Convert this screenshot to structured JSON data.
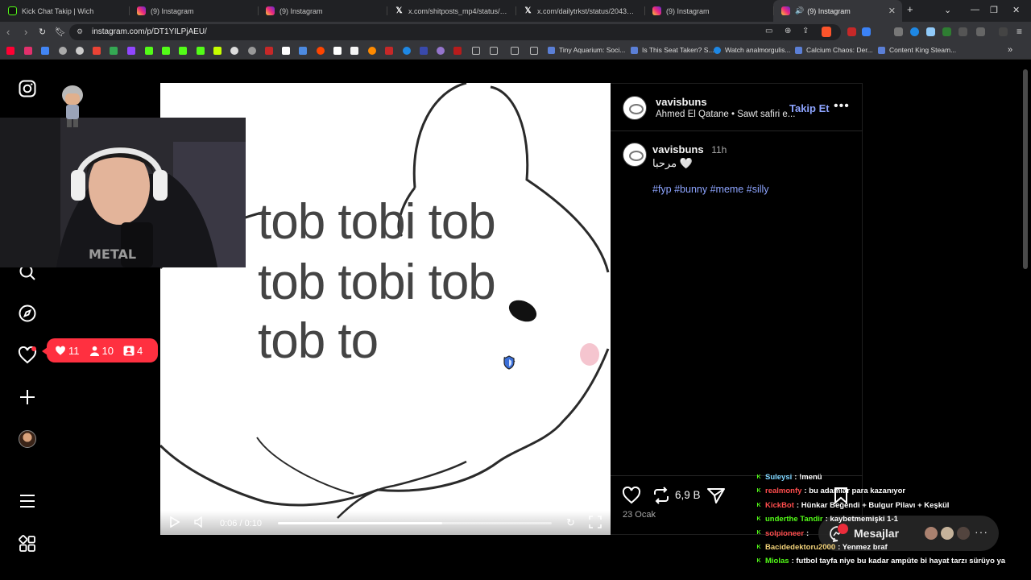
{
  "tabs": [
    {
      "title": "Kick Chat Takip | Wich",
      "icon": "kick-logo-icon"
    },
    {
      "title": "(9) Instagram",
      "icon": "instagram-icon"
    },
    {
      "title": "(9) Instagram",
      "icon": "instagram-icon"
    },
    {
      "title": "x.com/shitposts_mp4/status/20434",
      "icon": "x-icon"
    },
    {
      "title": "x.com/dailytrkst/status/204365050",
      "icon": "x-icon"
    },
    {
      "title": "(9) Instagram",
      "icon": "instagram-icon"
    },
    {
      "title": "(9) Instagram",
      "icon": "instagram-icon",
      "active": true
    }
  ],
  "address": {
    "url": "instagram.com/p/DT1YILPjAEU/"
  },
  "bookmarks": [
    {
      "label": "Tiny Aquarium: Soci..."
    },
    {
      "label": "Is This Seat Taken? S..."
    },
    {
      "label": "Watch analmorgulis..."
    },
    {
      "label": "Calcium Chaos: Der..."
    },
    {
      "label": "Content King Steam..."
    }
  ],
  "notifications": {
    "likes": "11",
    "follows": "10",
    "tags": "4"
  },
  "video": {
    "meme_lines": [
      "tob tobi tob",
      "tob tobi tob",
      "tob to"
    ],
    "time": "0:06 / 0:10",
    "progress": 0.6
  },
  "post": {
    "username": "vavisbuns",
    "audio": "Ahmed El Qatane • Sawt safiri e...",
    "follow_label": "Takip Et",
    "caption_user": "vavisbuns",
    "caption_time": "11h",
    "caption_text": "مرحبا 🤍",
    "hashtags": "#fyp #bunny #meme #silly",
    "reposts": "6,9 B",
    "date": "23 Ocak"
  },
  "messages": {
    "label": "Mesajlar"
  },
  "chat": [
    {
      "user": "Suleysi",
      "text": ": !menü",
      "color": "#7fd6ff"
    },
    {
      "user": "realmonfy",
      "text": ": bu adamlar para kazanıyor",
      "color": "#ff4d4d"
    },
    {
      "user": "KickBot",
      "text": ": Hünkar Beğendi + Bulgur Pilavı + Keşkül",
      "color": "#ff4d4d"
    },
    {
      "user": "underthe Tandir",
      "text": ": kaybetmemişki 1-1",
      "color": "#53fc18"
    },
    {
      "user": "solpioneer",
      "text": ":",
      "color": "#ff4d4d"
    },
    {
      "user": "Bacidedektoru2000",
      "text": ": Yenmez braf",
      "color": "#f3d37a"
    },
    {
      "user": "Miolas",
      "text": ": futbol tayfa niye bu kadar ampüte bi hayat tarzı sürüyo ya",
      "color": "#53fc18"
    }
  ],
  "colors": {
    "notif": "#ff3040",
    "link": "#8da4ff",
    "bg": "#000000"
  }
}
